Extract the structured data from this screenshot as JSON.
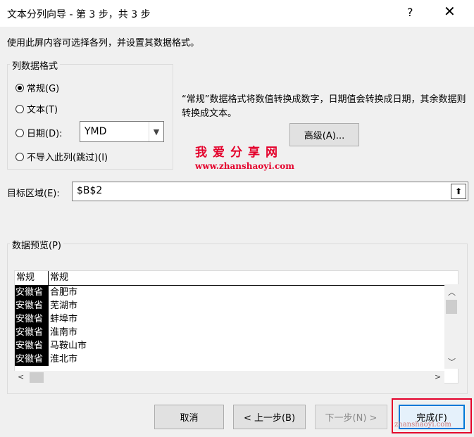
{
  "window": {
    "title": "文本分列向导 - 第 3 步，共 3 步",
    "help": "?",
    "close": "✕"
  },
  "description": "使用此屏内容可选择各列，并设置其数据格式。",
  "column_format": {
    "label": "列数据格式",
    "options": [
      {
        "label": "常规(G)",
        "selected": true
      },
      {
        "label": "文本(T)",
        "selected": false
      },
      {
        "label": "日期(D):",
        "selected": false
      },
      {
        "label": "不导入此列(跳过)(I)",
        "selected": false
      }
    ],
    "date_format": "YMD"
  },
  "info_text": "“常规”数据格式将数值转换成数字，日期值会转换成日期，其余数据则转换成文本。",
  "advanced_button": "高级(A)...",
  "watermark": {
    "line1": "我爱分享网",
    "line2": "www.zhanshaoyi.com",
    "line3": "zhanshaoyi.com"
  },
  "target": {
    "label": "目标区域(E):",
    "value": "$B$2"
  },
  "preview": {
    "label": "数据预览(P)",
    "headers": [
      "常规",
      "常规"
    ],
    "rows": [
      [
        "安徽省",
        "合肥市"
      ],
      [
        "安徽省",
        "芜湖市"
      ],
      [
        "安徽省",
        "蚌埠市"
      ],
      [
        "安徽省",
        "淮南市"
      ],
      [
        "安徽省",
        "马鞍山市"
      ],
      [
        "安徽省",
        "淮北市"
      ]
    ]
  },
  "buttons": {
    "cancel": "取消",
    "back": "< 上一步(B)",
    "next": "下一步(N) >",
    "finish": "完成(F)"
  },
  "colors": {
    "accent": "#0078d7",
    "highlight": "#e4002b"
  }
}
